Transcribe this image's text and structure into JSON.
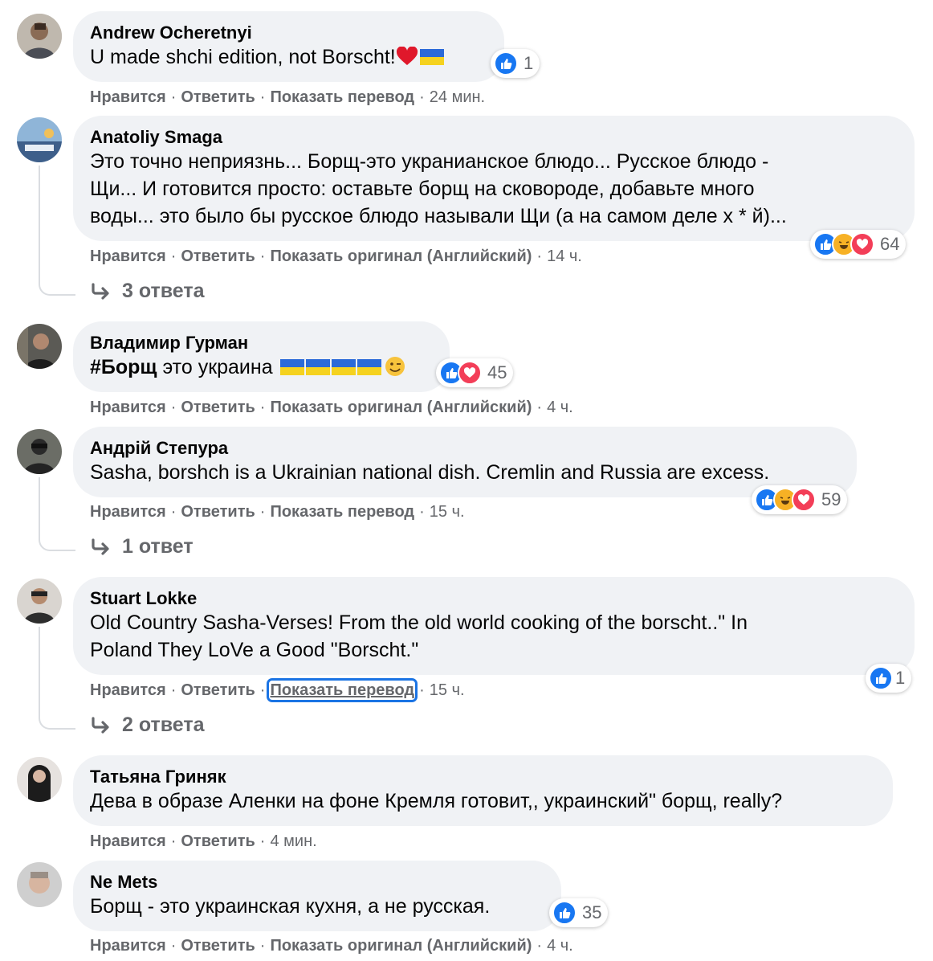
{
  "actions": {
    "like": "Нравится",
    "reply": "Ответить",
    "show_translation": "Показать перевод",
    "show_original": "Показать оригинал (Английский)",
    "sep": "·"
  },
  "colors": {
    "bubble": "#f0f2f5",
    "meta": "#65676b",
    "like": "#1877f2",
    "love": "#f33e58",
    "haha": "#f7b125",
    "ukraine_blue": "#2b6ad8",
    "ukraine_yellow": "#f5d21f"
  },
  "comments": [
    {
      "author": "Andrew Ocheretnyi",
      "lines": [
        "U made shchi edition, not Borscht!"
      ],
      "emoji": [
        "red-heart",
        "ukraine-flag"
      ],
      "reactions": [
        "like"
      ],
      "reaction_count": "1",
      "time": "24 мин."
    },
    {
      "author": "Anatoliy Smaga",
      "lines": [
        "Это точно неприязнь... Борщ-это укранианское блюдо... Русское блюдо -",
        "Щи... И готовится просто: оставьте борщ на сковороде, добавьте много",
        "воды... это было бы русское блюдо называли Щи (а на самом деле х * й)..."
      ],
      "reactions": [
        "like",
        "haha",
        "love"
      ],
      "reaction_count": "64",
      "time": "14 ч.",
      "replies": "3 ответа"
    },
    {
      "author": "Владимир Гурман",
      "hashtag": "#Борщ",
      "lines": [
        " это украина "
      ],
      "emoji": [
        "ukraine-flag",
        "ukraine-flag",
        "ukraine-flag",
        "ukraine-flag",
        "winking-face"
      ],
      "reactions": [
        "like",
        "love"
      ],
      "reaction_count": "45",
      "time": "4 ч."
    },
    {
      "author": "Андрій Степура",
      "lines": [
        "Sasha, borshch is a Ukrainian national dish. Cremlin and Russia are excess."
      ],
      "reactions": [
        "like",
        "haha",
        "love"
      ],
      "reaction_count": "59",
      "time": "15 ч.",
      "replies": "1 ответ"
    },
    {
      "author": "Stuart Lokke",
      "lines": [
        "Old Country Sasha-Verses! From the old world cooking of the borscht..\" In",
        "Poland They LoVe a Good \"Borscht.\""
      ],
      "reactions": [
        "like"
      ],
      "reaction_count": "1",
      "time": "15 ч.",
      "replies": "2 ответа"
    },
    {
      "author": "Татьяна Гриняк",
      "lines": [
        "Дева в образе Аленки на фоне Кремля готовит,, украинский\" борщ, really?"
      ],
      "time": "4 мин."
    },
    {
      "author": "Ne Mets",
      "lines": [
        "Борщ - это украинская кухня, а не русская."
      ],
      "reactions": [
        "like"
      ],
      "reaction_count": "35",
      "time": "4 ч."
    }
  ]
}
